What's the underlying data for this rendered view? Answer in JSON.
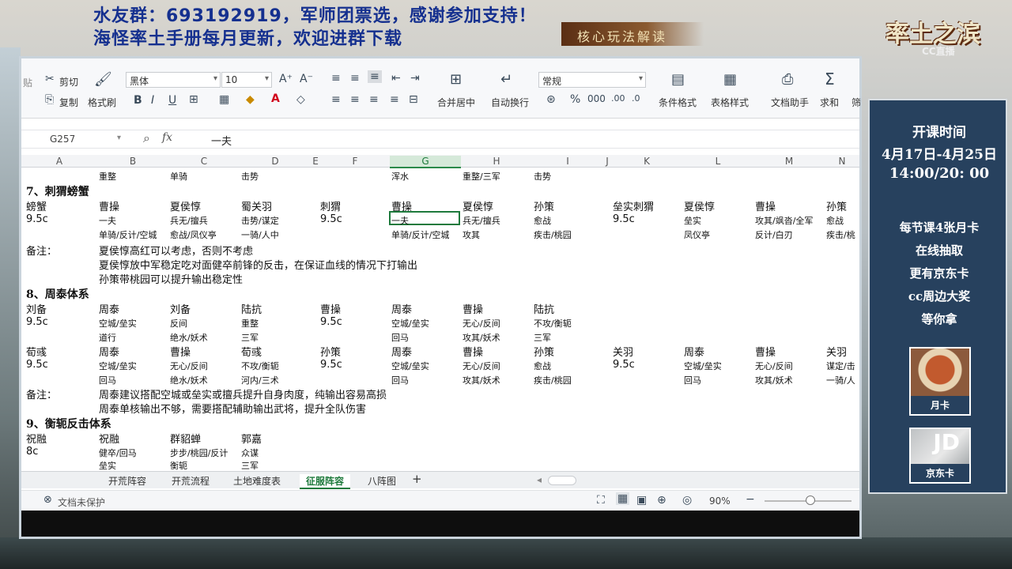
{
  "banner": {
    "line1": "水友群：693192919，军师团票选，感谢参加支持！",
    "line2": "海怪率土手册每月更新，欢迎进群下载",
    "core_tag": "核心玩法解读"
  },
  "logo": {
    "title": "率土之滨",
    "sub": "CC直播"
  },
  "side_panel": {
    "time_title": "开课时间",
    "date_range": "4月17日-4月25日",
    "time_range": "14:00/20: 00",
    "promo": [
      "每节课4张月卡",
      "在线抽取",
      "更有京东卡",
      "cc周边大奖",
      "等你拿"
    ],
    "card1_label": "月卡",
    "card2_label": "京东卡"
  },
  "ribbon": {
    "cut": "剪切",
    "copy": "复制",
    "format_painter": "格式刷",
    "paste": "贴",
    "font": "黑体",
    "size": "10",
    "bold": "B",
    "italic": "I",
    "underline": "U",
    "merge": "合并居中",
    "wrap": "自动换行",
    "number_format": "常规",
    "cond_format": "条件格式",
    "table_style": "表格样式",
    "doc_helper": "文档助手",
    "sum": "求和",
    "filter": "筛"
  },
  "formula_bar": {
    "cell": "G257",
    "fx": "fx",
    "value": "一夫"
  },
  "columns": [
    "A",
    "B",
    "C",
    "D",
    "E",
    "F",
    "G",
    "H",
    "I",
    "J",
    "K",
    "L",
    "M",
    "N"
  ],
  "grid": {
    "r0": [
      "重整",
      "单骑",
      "击势",
      "浑水",
      "重整/三军",
      "击势"
    ],
    "sec7": "7、刺猬螃蟹",
    "r7a": [
      "螃蟹",
      "曹操",
      "夏侯惇",
      "蜀关羽",
      "刺猬",
      "曹操",
      "夏侯惇",
      "孙策",
      "垒实刺猬",
      "夏侯惇",
      "曹操",
      "孙策"
    ],
    "r7b": [
      "9.5c",
      "一夫",
      "兵无/擅兵",
      "击势/谋定",
      "9.5c",
      "一夫",
      "兵无/擅兵",
      "愈战",
      "9.5c",
      "垒实",
      "攻其/飒沓/全军",
      "愈战"
    ],
    "r7c": [
      "单骑/反计/空城",
      "愈战/凤仪亭",
      "一骑/人中",
      "单骑/反计/空城",
      "攻其",
      "疾击/桃园",
      "凤仪亭",
      "反计/白刃",
      "疾击/桃"
    ],
    "note_label": "备注：",
    "note7": [
      "夏侯惇高红可以考虑，否则不考虑",
      "夏侯惇放中军稳定吃对面健卒前锋的反击，在保证血线的情况下打输出",
      "孙策带桃园可以提升输出稳定性"
    ],
    "sec8": "8、周泰体系",
    "r8a": [
      "刘备",
      "周泰",
      "刘备",
      "陆抗",
      "曹操",
      "周泰",
      "曹操",
      "陆抗"
    ],
    "r8b": [
      "9.5c",
      "空城/垒实",
      "反间",
      "重整",
      "9.5c",
      "空城/垒实",
      "无心/反间",
      "不攻/衡轭"
    ],
    "r8c": [
      "道行",
      "绝水/妖术",
      "三军",
      "回马",
      "攻其/妖术",
      "三军"
    ],
    "r8d": [
      "荀彧",
      "周泰",
      "曹操",
      "荀彧",
      "孙策",
      "周泰",
      "曹操",
      "孙策",
      "关羽",
      "周泰",
      "曹操",
      "关羽"
    ],
    "r8e": [
      "9.5c",
      "空城/垒实",
      "无心/反间",
      "不攻/衡轭",
      "9.5c",
      "空城/垒实",
      "无心/反间",
      "愈战",
      "9.5c",
      "空城/垒实",
      "无心/反间",
      "谋定/击"
    ],
    "r8f": [
      "回马",
      "绝水/妖术",
      "河内/三术",
      "回马",
      "攻其/妖术",
      "疾击/桃园",
      "回马",
      "攻其/妖术",
      "一骑/人"
    ],
    "note8": [
      "周泰建议搭配空城或垒实或擅兵提升自身肉度，纯输出容易高损",
      "周泰单核输出不够，需要搭配辅助输出武将，提升全队伤害"
    ],
    "sec9": "9、衡轭反击体系",
    "r9a": [
      "祝融",
      "祝融",
      "群貂蝉",
      "郭嘉"
    ],
    "r9b": [
      "8c",
      "健卒/回马",
      "步步/桃园/反计",
      "众谋"
    ],
    "r9c": [
      "垒实",
      "衡轭",
      "三军"
    ]
  },
  "sheets": [
    "开荒阵容",
    "开荒流程",
    "土地难度表",
    "征服阵容",
    "八阵图"
  ],
  "status": {
    "protect": "文档未保护",
    "zoom": "90%"
  }
}
